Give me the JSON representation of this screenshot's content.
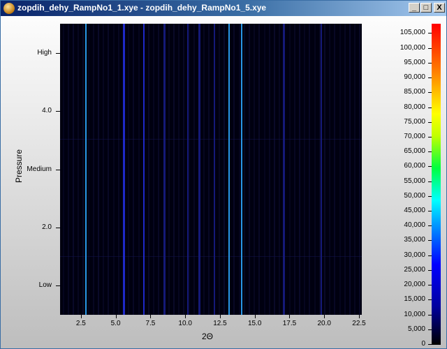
{
  "window": {
    "title": "zopdih_dehy_RampNo1_1.xye - zopdih_dehy_RampNo1_5.xye",
    "icon": "app-orb-icon",
    "controls": {
      "minimize": "_",
      "maximize": "□",
      "close": "X"
    }
  },
  "chart_data": {
    "type": "heatmap",
    "xlabel": "2Θ",
    "ylabel": "Pressure",
    "xlim": [
      1,
      22.7
    ],
    "x_ticks": [
      "2.5",
      "5.0",
      "7.5",
      "10.0",
      "12.5",
      "15.0",
      "17.5",
      "20.0",
      "22.5"
    ],
    "y_ticks": [
      "Low",
      "2.0",
      "Medium",
      "4.0",
      "High"
    ],
    "colorbar_ticks": [
      "0",
      "5,000",
      "10,000",
      "15,000",
      "20,000",
      "25,000",
      "30,000",
      "35,000",
      "40,000",
      "45,000",
      "50,000",
      "55,000",
      "60,000",
      "65,000",
      "70,000",
      "75,000",
      "80,000",
      "85,000",
      "90,000",
      "95,000",
      "100,000",
      "105,000"
    ],
    "colorbar_range": [
      0,
      107000
    ],
    "colormap": "black-blue-cyan-green-yellow-red",
    "peaks_2theta": [
      {
        "x": 2.85,
        "intensity": 38000
      },
      {
        "x": 5.6,
        "intensity": 14000
      },
      {
        "x": 7.05,
        "intensity": 16000
      },
      {
        "x": 8.5,
        "intensity": 8000
      },
      {
        "x": 10.2,
        "intensity": 9000
      },
      {
        "x": 11.0,
        "intensity": 9000
      },
      {
        "x": 12.1,
        "intensity": 7000
      },
      {
        "x": 13.15,
        "intensity": 42000
      },
      {
        "x": 14.05,
        "intensity": 44000
      },
      {
        "x": 17.1,
        "intensity": 12000
      },
      {
        "x": 19.8,
        "intensity": 6000
      }
    ]
  }
}
